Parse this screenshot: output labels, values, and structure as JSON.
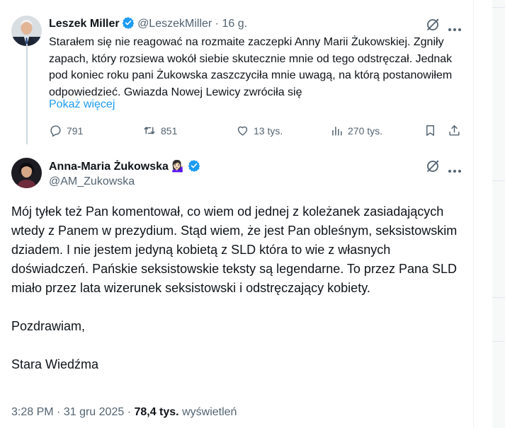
{
  "tweet1": {
    "author_name": "Leszek Miller",
    "handle": "@LeszekMiller",
    "separator": "·",
    "time": "16 g.",
    "text": "Starałem się nie reagować na rozmaite zaczepki Anny Marii Żukowskiej. Zgniły zapach, który rozsiewa wokół siebie skutecznie mnie od tego odstręczał. Jednak pod koniec roku pani Żukowska zaszczyciła mnie uwagą, na którą postanowiłem odpowiedzieć. Gwiazda Nowej Lewicy zwróciła się",
    "show_more": "Pokaż więcej",
    "actions": {
      "replies": "791",
      "reposts": "851",
      "likes": "13 tys.",
      "views": "270 tys."
    }
  },
  "tweet2": {
    "author_name": "Anna-Maria Żukowska",
    "emoji": "💁🏻‍♀️",
    "handle": "@AM_Zukowska",
    "paragraphs": [
      "Mój tyłek też Pan komentował, co wiem od jednej z koleżanek zasiadających wtedy z Panem w prezydium. Stąd wiem, że jest Pan obleśnym, seksistowskim dziadem. I nie jestem jedyną kobietą z SLD która to wie z własnych doświadczeń. Pańskie seksistowskie teksty są legendarne. To przez Pana SLD miało przez lata wizerunek seksistowski i odstręczający kobiety.",
      "Pozdrawiam,",
      "Stara Wiedźma"
    ],
    "meta": {
      "time": "3:28 PM",
      "separator1": "·",
      "date": "31 gru 2025",
      "separator2": "·",
      "views_count": "78,4 tys.",
      "views_label": "wyświetleń"
    }
  },
  "colors": {
    "text": "#0f1419",
    "muted": "#536471",
    "link": "#1d9bf0",
    "verified": "#1d9bf0",
    "divider": "#eff3f4"
  },
  "icons": [
    "verified-badge-icon",
    "grok-icon",
    "more-icon",
    "reply-icon",
    "repost-icon",
    "like-icon",
    "views-icon",
    "bookmark-icon",
    "share-icon"
  ]
}
